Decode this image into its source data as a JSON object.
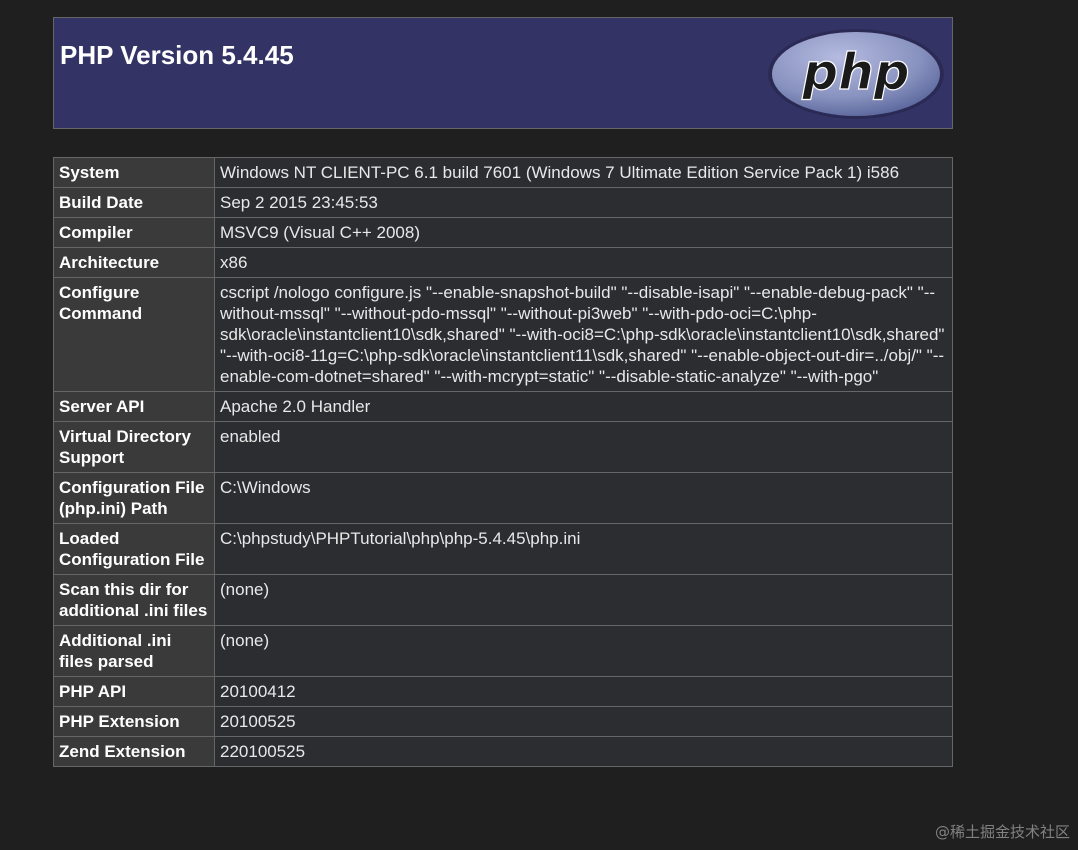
{
  "header": {
    "title": "PHP Version 5.4.45",
    "logo_text": "php"
  },
  "rows": [
    {
      "key": "System",
      "value": "Windows NT CLIENT-PC 6.1 build 7601 (Windows 7 Ultimate Edition Service Pack 1) i586"
    },
    {
      "key": "Build Date",
      "value": "Sep 2 2015 23:45:53"
    },
    {
      "key": "Compiler",
      "value": "MSVC9 (Visual C++ 2008)"
    },
    {
      "key": "Architecture",
      "value": "x86"
    },
    {
      "key": "Configure Command",
      "value": "cscript /nologo configure.js \"--enable-snapshot-build\" \"--disable-isapi\" \"--enable-debug-pack\" \"--without-mssql\" \"--without-pdo-mssql\" \"--without-pi3web\" \"--with-pdo-oci=C:\\php-sdk\\oracle\\instantclient10\\sdk,shared\" \"--with-oci8=C:\\php-sdk\\oracle\\instantclient10\\sdk,shared\" \"--with-oci8-11g=C:\\php-sdk\\oracle\\instantclient11\\sdk,shared\" \"--enable-object-out-dir=../obj/\" \"--enable-com-dotnet=shared\" \"--with-mcrypt=static\" \"--disable-static-analyze\" \"--with-pgo\""
    },
    {
      "key": "Server API",
      "value": "Apache 2.0 Handler"
    },
    {
      "key": "Virtual Directory Support",
      "value": "enabled"
    },
    {
      "key": "Configuration File (php.ini) Path",
      "value": "C:\\Windows"
    },
    {
      "key": "Loaded Configuration File",
      "value": "C:\\phpstudy\\PHPTutorial\\php\\php-5.4.45\\php.ini"
    },
    {
      "key": "Scan this dir for additional .ini files",
      "value": "(none)"
    },
    {
      "key": "Additional .ini files parsed",
      "value": "(none)"
    },
    {
      "key": "PHP API",
      "value": "20100412"
    },
    {
      "key": "PHP Extension",
      "value": "20100525"
    },
    {
      "key": "Zend Extension",
      "value": "220100525"
    }
  ],
  "watermark": "@稀土掘金技术社区",
  "colors": {
    "background": "#1f1f1f",
    "header_bg": "#343366",
    "key_cell_bg": "#3a3a3a",
    "value_cell_bg": "#2b2d31",
    "logo_ellipse": "#8892bf"
  }
}
